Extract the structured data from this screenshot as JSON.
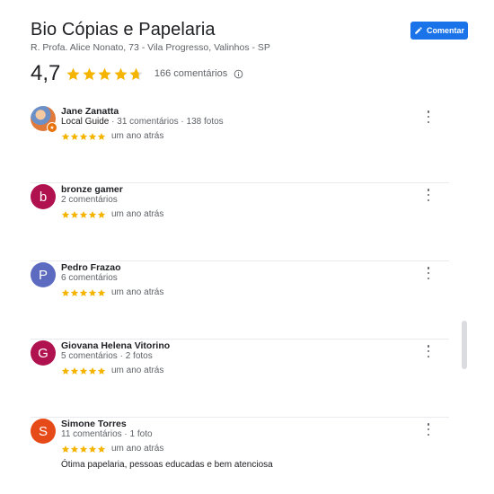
{
  "place": {
    "name": "Bio Cópias e Papelaria",
    "address": "R. Profa. Alice Nonato, 73 - Vila Progresso, Valinhos - SP",
    "rating": "4,7",
    "rating_value": 4.7,
    "review_count": "166 comentários"
  },
  "actions": {
    "comment_label": "Comentar"
  },
  "icons": {
    "comment": "pencil-icon",
    "info": "info-icon",
    "more": "more-vert-icon",
    "star": "star-icon"
  },
  "colors": {
    "accent": "#1a73e8",
    "star": "#f4b400"
  },
  "reviews": [
    {
      "name": "Jane Zanatta",
      "avatar_letter": "",
      "avatar_color": "",
      "has_photo": true,
      "local_guide": "Local Guide",
      "meta": " · 31 comentários · 138 fotos",
      "stars": 5,
      "date": "um ano atrás",
      "text": ""
    },
    {
      "name": "bronze gamer",
      "avatar_letter": "b",
      "avatar_color": "#b0124f",
      "has_photo": false,
      "local_guide": "",
      "meta": "2 comentários",
      "stars": 5,
      "date": "um ano atrás",
      "text": ""
    },
    {
      "name": "Pedro Frazao",
      "avatar_letter": "P",
      "avatar_color": "#5c6bc0",
      "has_photo": false,
      "local_guide": "",
      "meta": "6 comentários",
      "stars": 5,
      "date": "um ano atrás",
      "text": ""
    },
    {
      "name": "Giovana Helena Vitorino",
      "avatar_letter": "G",
      "avatar_color": "#b0124f",
      "has_photo": false,
      "local_guide": "",
      "meta": "5 comentários · 2 fotos",
      "stars": 5,
      "date": "um ano atrás",
      "text": ""
    },
    {
      "name": "Simone Torres",
      "avatar_letter": "S",
      "avatar_color": "#e64a19",
      "has_photo": false,
      "local_guide": "",
      "meta": "11 comentários · 1 foto",
      "stars": 5,
      "date": "um ano atrás",
      "text": "Ótima papelaria, pessoas educadas e bem atenciosa"
    }
  ]
}
